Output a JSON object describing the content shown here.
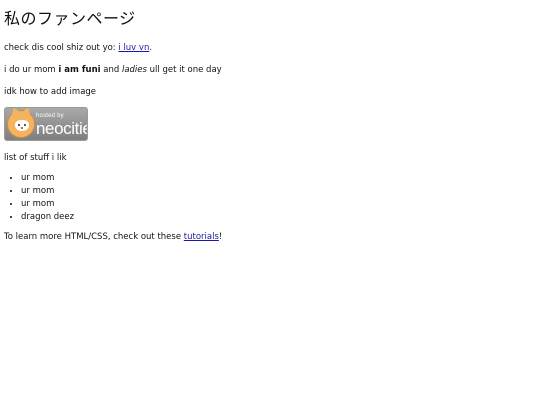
{
  "title": "私のファンページ",
  "intro": {
    "prefix": "check dis cool shiz out yo: ",
    "link_text": "i luv vn",
    "suffix": "."
  },
  "mom_line": {
    "prefix": "i do ur mom ",
    "bold": "i am funi",
    "middle": " and ",
    "italic": "ladies",
    "suffix": " ull get it one day"
  },
  "image_note": "idk how to add image",
  "badge": {
    "small_text": "hosted by",
    "brand_text": "neocities"
  },
  "list_heading": "list of stuff i lik",
  "list_items": [
    "ur mom",
    "ur mom",
    "ur mom",
    "dragon deez"
  ],
  "footer": {
    "prefix": "To learn more HTML/CSS, check out these ",
    "link_text": "tutorials",
    "suffix": "!"
  }
}
